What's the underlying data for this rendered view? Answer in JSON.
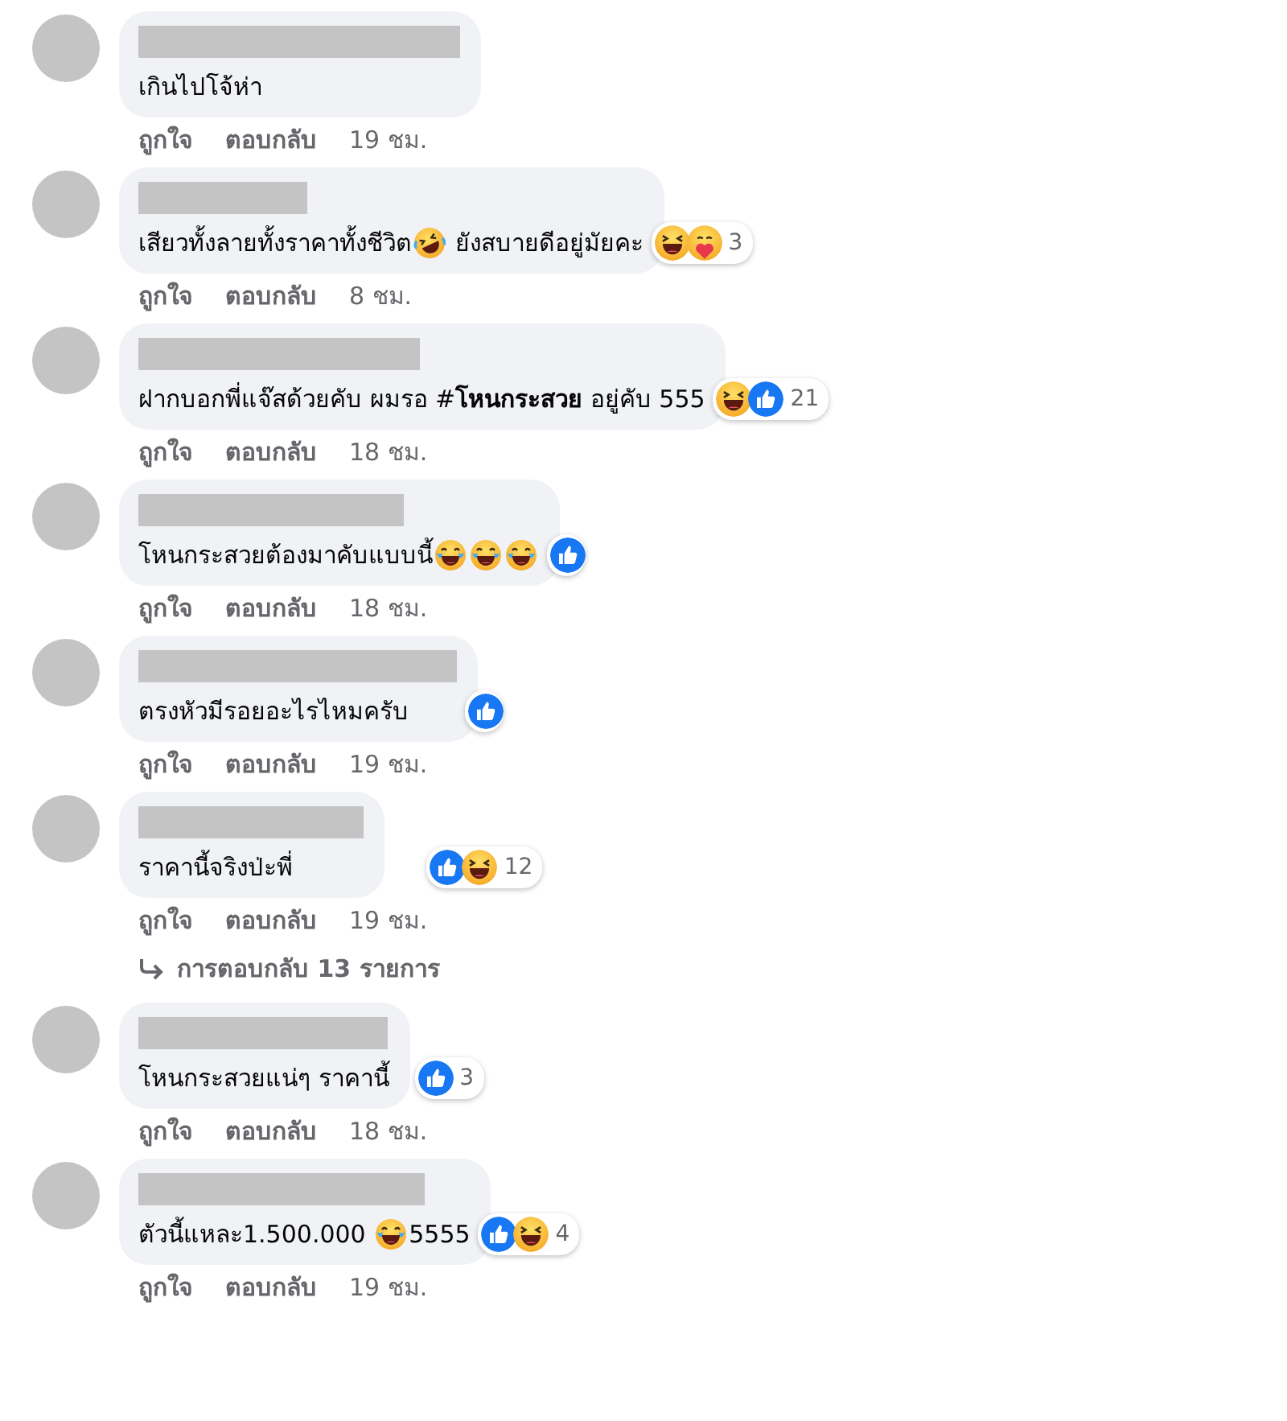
{
  "comments": [
    {
      "parts": [
        {
          "kind": "text",
          "text": "เกินไปโจ้ห่า"
        }
      ],
      "actions": [
        "ถูกใจ",
        "ตอบกลับ"
      ],
      "time": "19 ชม."
    },
    {
      "parts": [
        {
          "kind": "text",
          "text": "เสียวทั้งลายทั้งราคาทั้งชีวิต"
        },
        {
          "kind": "rofl"
        },
        {
          "kind": "text",
          "text": " ยังสบายดีอยู่มัยคะ"
        }
      ],
      "reactions": {
        "icons": [
          {
            "kind": "haha"
          },
          {
            "kind": "care"
          }
        ],
        "count": "3"
      },
      "actions": [
        "ถูกใจ",
        "ตอบกลับ"
      ],
      "time": "8 ชม."
    },
    {
      "parts": [
        {
          "kind": "text",
          "text": "ฝากบอกพี่แจ๊สด้วยคับ ผมรอ #**โหนกระสวย** อยู่คับ 555"
        }
      ],
      "reactions": {
        "icons": [
          {
            "kind": "haha"
          },
          {
            "kind": "like"
          }
        ],
        "count": "21"
      },
      "actions": [
        "ถูกใจ",
        "ตอบกลับ"
      ],
      "time": "18 ชม."
    },
    {
      "parts": [
        {
          "kind": "text",
          "text": "โหนกระสวยต้องมาคับแบบนี้"
        },
        {
          "kind": "joy"
        },
        {
          "kind": "joy"
        },
        {
          "kind": "joy"
        }
      ],
      "reactions": {
        "icons": [
          {
            "kind": "like"
          }
        ]
      },
      "actions": [
        "ถูกใจ",
        "ตอบกลับ"
      ],
      "time": "18 ชม."
    },
    {
      "parts": [
        {
          "kind": "text",
          "text": "ตรงหัวมีรอยอะไรไหมครับ"
        }
      ],
      "reactions": {
        "icons": [
          {
            "kind": "like"
          }
        ]
      },
      "actions": [
        "ถูกใจ",
        "ตอบกลับ"
      ],
      "time": "19 ชม."
    },
    {
      "parts": [
        {
          "kind": "text",
          "text": "ราคานี้จริงป่ะพี่"
        }
      ],
      "reactions": {
        "icons": [
          {
            "kind": "like"
          },
          {
            "kind": "haha"
          }
        ],
        "count": "12"
      },
      "actions": [
        "ถูกใจ",
        "ตอบกลับ"
      ],
      "time": "19 ชม.",
      "replies": "การตอบกลับ 13 รายการ"
    },
    {
      "parts": [
        {
          "kind": "text",
          "text": "โหนกระสวยแน่ๆ ราคานี้"
        }
      ],
      "reactions": {
        "icons": [
          {
            "kind": "like"
          }
        ],
        "count": "3"
      },
      "actions": [
        "ถูกใจ",
        "ตอบกลับ"
      ],
      "time": "18 ชม."
    },
    {
      "parts": [
        {
          "kind": "text",
          "text": "ตัวนี้แหละ1.500.000 "
        },
        {
          "kind": "joy"
        },
        {
          "kind": "text",
          "text": "5555"
        }
      ],
      "reactions": {
        "icons": [
          {
            "kind": "like"
          },
          {
            "kind": "haha"
          }
        ],
        "count": "4"
      },
      "actions": [
        "ถูกใจ",
        "ตอบกลับ"
      ],
      "time": "19 ชม."
    }
  ]
}
